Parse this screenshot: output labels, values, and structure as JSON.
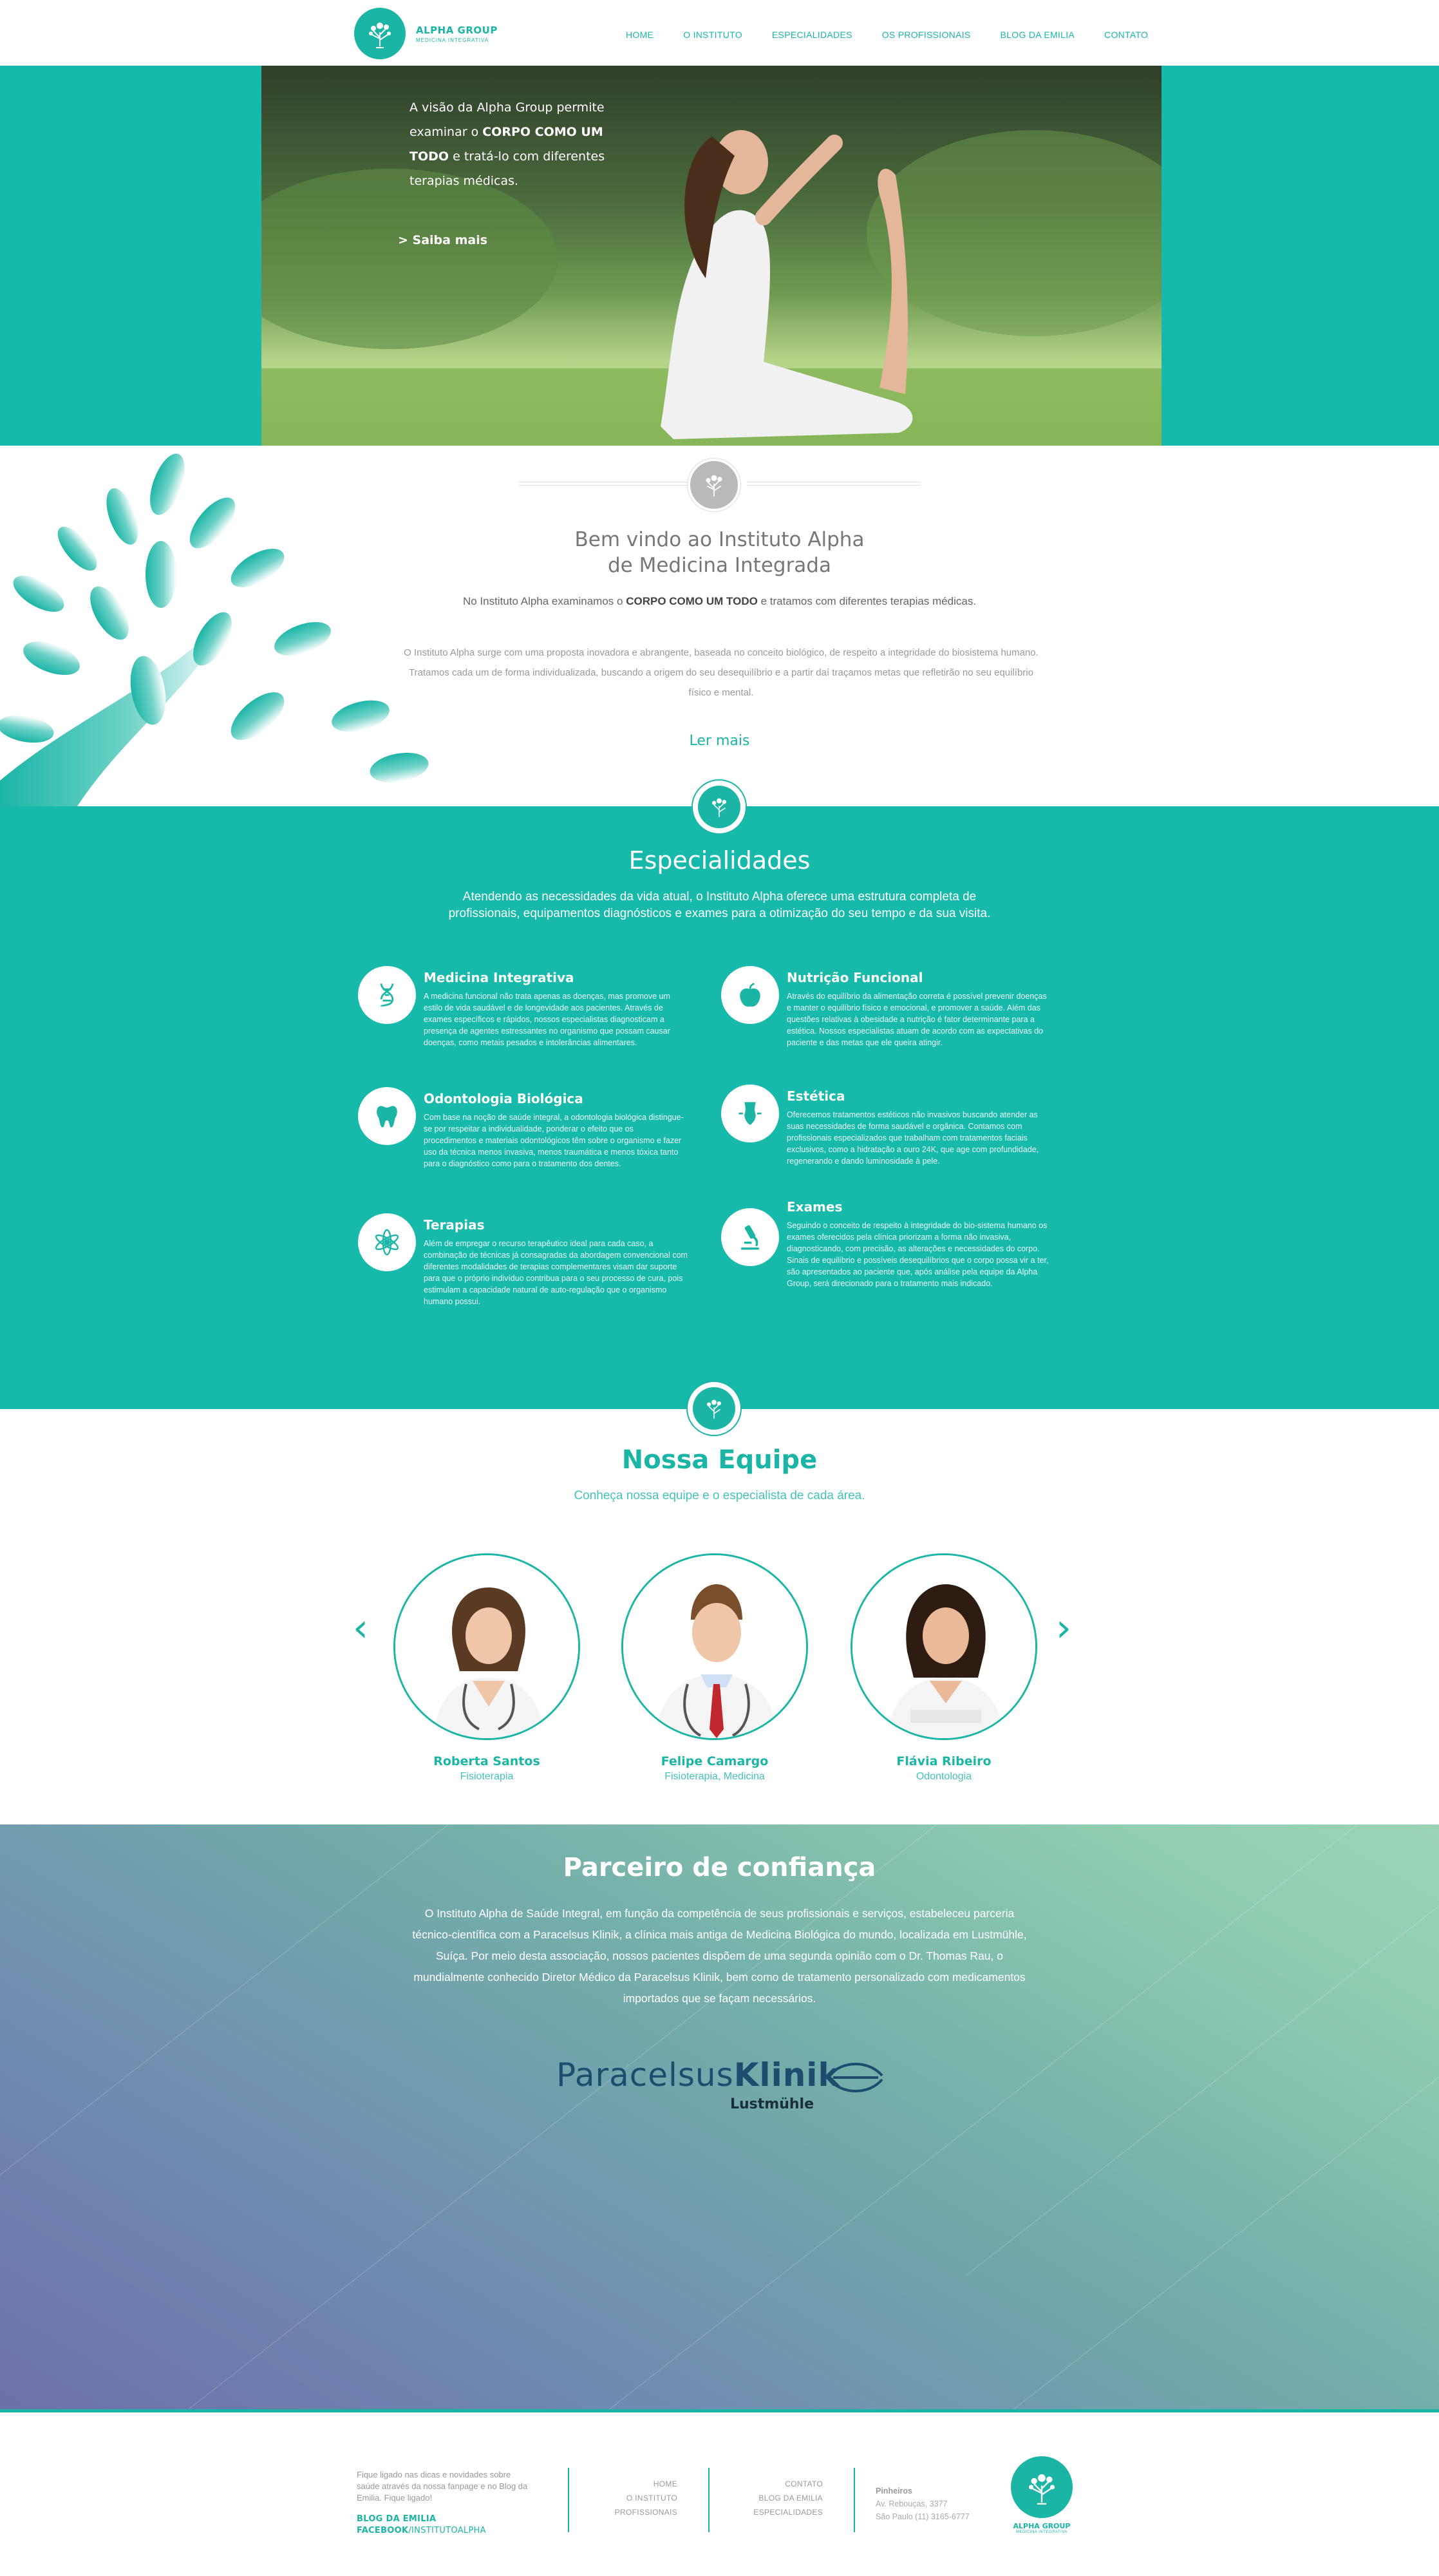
{
  "brand": {
    "name": "ALPHA GROUP",
    "tagline": "MEDICINA INTEGRATIVA"
  },
  "nav": [
    "HOME",
    "O INSTITUTO",
    "ESPECIALIDADES",
    "OS PROFISSIONAIS",
    "BLOG DA EMILIA",
    "CONTATO"
  ],
  "hero": {
    "text_1": "A visão da Alpha Group permite examinar o ",
    "text_bold": "CORPO COMO UM TODO",
    "text_2": " e tratá-lo com diferentes terapias médicas.",
    "more": "> Saiba mais"
  },
  "welcome": {
    "title_line1": "Bem vindo ao Instituto Alpha",
    "title_line2": "de Medicina Integrada",
    "lead_1": "No Instituto Alpha examinamos o ",
    "lead_bold": "CORPO COMO UM TODO",
    "lead_2": " e tratamos com diferentes terapias médicas.",
    "body": "O Instituto Alpha surge com uma proposta inovadora e abrangente, baseada no conceito biológico, de respeito a integridade do biosistema humano. Tratamos cada um de forma individualizada, buscando a origem do seu desequilíbrio e a partir daí traçamos metas que refletirão no seu equilíbrio físico e mental.",
    "more": "Ler mais"
  },
  "specialties": {
    "title": "Especialidades",
    "lead": "Atendendo as necessidades da vida atual, o Instituto Alpha oferece uma estrutura completa de profissionais, equipamentos diagnósticos e exames para a otimização do seu tempo e da sua visita.",
    "items": [
      {
        "icon": "dna-icon",
        "title": "Medicina Integrativa",
        "text": "A medicina funcional não trata apenas as doenças, mas promove um estilo de vida saudável e de longevidade aos pacientes. Através de exames específicos e rápidos, nossos especialistas diagnosticam a presença de agentes estressantes no organismo que possam causar doenças, como metais pesados e intolerâncias alimentares."
      },
      {
        "icon": "apple-icon",
        "title": "Nutrição Funcional",
        "text": "Através do equilíbrio da alimentação correta é possível prevenir doenças e manter o equilíbrio físico e emocional, e promover a saúde. Além das questões relativas à obesidade a nutrição é fator determinante para a estética. Nossos especialistas atuam de acordo com as expectativas do paciente e das metas que ele queira atingir."
      },
      {
        "icon": "tooth-icon",
        "title": "Odontologia Biológica",
        "text": "Com base na noção de saúde integral, a odontologia biológica distingue-se por respeitar a individualidade, ponderar o efeito que os procedimentos e materiais odontológicos têm sobre o organismo e fazer uso da técnica menos invasiva, menos traumática e menos tóxica tanto para o diagnóstico como para o tratamento dos dentes."
      },
      {
        "icon": "body-icon",
        "title": "Estética",
        "text": "Oferecemos tratamentos estéticos não invasivos buscando atender as suas necessidades de forma saudável e orgânica. Contamos com profissionais especializados que trabalham com tratamentos faciais exclusivos, como a hidratação a ouro 24K, que age com profundidade, regenerando e dando luminosidade à pele."
      },
      {
        "icon": "lotus-icon",
        "title": "Terapias",
        "text": "Além de empregar o recurso terapêutico ideal para cada caso, a combinação de técnicas já consagradas da abordagem convencional com diferentes modalidades de terapias complementares visam dar suporte para que o próprio indivíduo contribua para o seu processo de cura, pois estimulam a capacidade natural de auto-regulação que o organismo humano possui."
      },
      {
        "icon": "microscope-icon",
        "title": "Exames",
        "text": "Seguindo o conceito de respeito à integridade do bio-sistema humano os exames oferecidos pela clínica priorizam a forma não invasiva, diagnosticando, com precisão, as alterações e necessidades do corpo. Sinais de equilíbrio e possíveis desequilíbrios que o corpo possa vir a ter, são apresentados ao paciente que, após análise pela equipe da Alpha Group, será direcionado para o tratamento mais indicado."
      }
    ]
  },
  "team": {
    "title": "Nossa Equipe",
    "lead": "Conheça nossa equipe e o especialista de cada área.",
    "members": [
      {
        "name": "Roberta Santos",
        "role": "Fisioterapia"
      },
      {
        "name": "Felipe Camargo",
        "role": "Fisioterapia, Medicina"
      },
      {
        "name": "Flávia Ribeiro",
        "role": "Odontologia"
      }
    ]
  },
  "partner": {
    "title": "Parceiro de confiança",
    "body": "O Instituto Alpha de Saúde Integral, em função da competência de seus profissionais e serviços, estabeleceu parceria técnico-científica com a Paracelsus Klinik, a clínica mais antiga de Medicina Biológica do mundo, localizada em Lustmühle, Suíça. Por meio desta associação, nossos pacientes dispõem de uma segunda opinião com o Dr. Thomas Rau, o mundialmente conhecido Diretor Médico da Paracelsus Klinik, bem como de tratamento personalizado com medicamentos importados que se façam necessários.",
    "logo_name_1": "Paracelsus",
    "logo_name_2": "Klinik",
    "logo_sub": "Lustmühle"
  },
  "footer": {
    "message": "Fique ligado nas dicas e novidades sobre saúde através da nossa fanpage e no Blog da Emilia. Fique ligado!",
    "blog_link": "BLOG DA EMILIA",
    "facebook_bold": "FACEBOOK",
    "facebook_rest": "/INSTITUTOALPHA",
    "menu_col1": [
      "HOME",
      "O INSTITUTO",
      "PROFISSIONAIS"
    ],
    "menu_col2": [
      "CONTATO",
      "BLOG DA EMILIA",
      "ESPECIALIDADES"
    ],
    "address_title": "Pinheiros",
    "address_line1": "Av. Rebouças, 3377",
    "address_line2": "São Paulo (11) 3165-6777"
  },
  "colors": {
    "accent": "#1bb5a6",
    "brand_dark": "#1d4c6d"
  }
}
